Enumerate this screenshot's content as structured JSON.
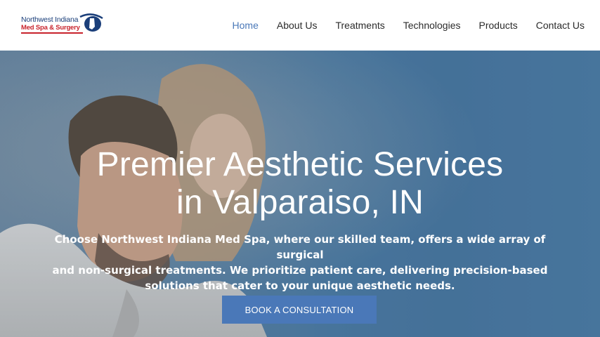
{
  "logo": {
    "line1": "Northwest Indiana",
    "line2": "Med Spa & Surgery"
  },
  "nav": {
    "items": [
      {
        "label": "Home",
        "active": true
      },
      {
        "label": "About Us",
        "active": false
      },
      {
        "label": "Treatments",
        "active": false
      },
      {
        "label": "Technologies",
        "active": false
      },
      {
        "label": "Products",
        "active": false
      },
      {
        "label": "Contact Us",
        "active": false
      }
    ]
  },
  "hero": {
    "title_line1": "Premier Aesthetic Services",
    "title_line2": "in Valparaiso, IN",
    "subtitle_line1": "Choose Northwest Indiana Med Spa, where our skilled team, offers a wide array of surgical",
    "subtitle_line2": "and non-surgical treatments. We prioritize patient care, delivering precision-based",
    "subtitle_line3": "solutions that cater to your unique aesthetic needs.",
    "cta_label": "BOOK A CONSULTATION"
  },
  "colors": {
    "accent": "#4a78b8",
    "logo_blue": "#1b3f7a",
    "logo_red": "#c8232c",
    "nav_text": "#2b2b2b",
    "hero_text": "#ffffff"
  },
  "icons": {
    "logo_mark": "indiana-state-swoosh-icon"
  }
}
